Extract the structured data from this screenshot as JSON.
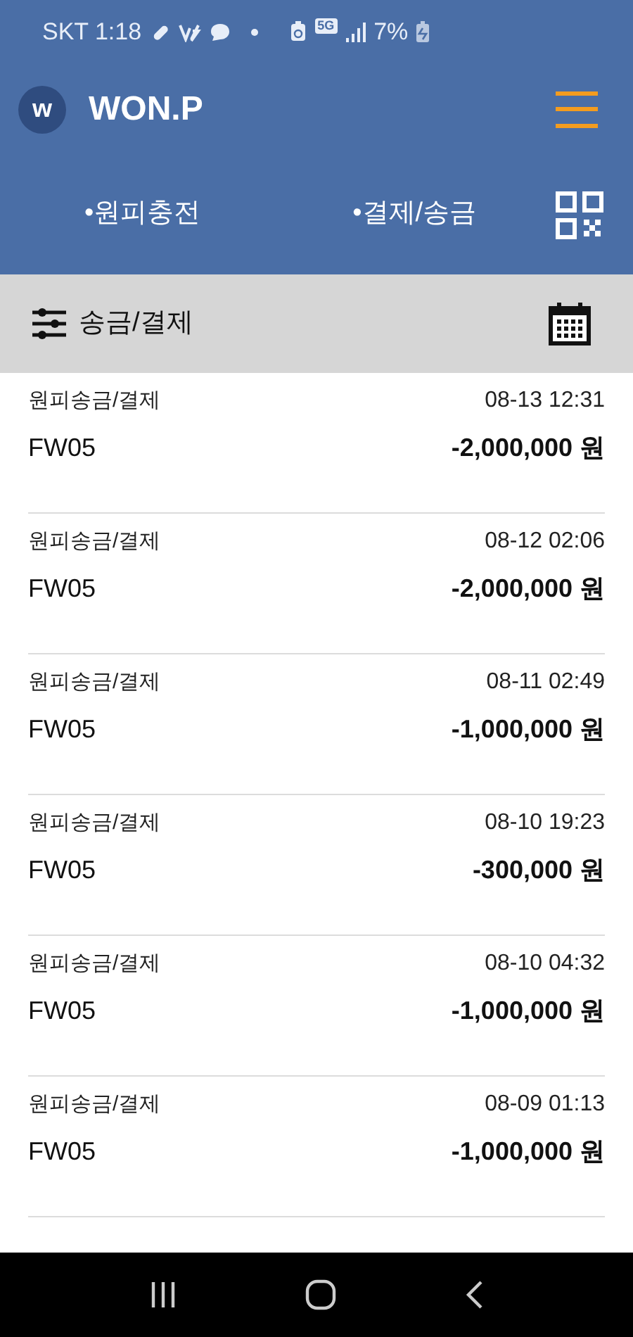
{
  "status_bar": {
    "carrier_time": "SKT 1:18",
    "network": "5G",
    "battery": "7%"
  },
  "header": {
    "app_name": "WON.P",
    "logo_letter": "w"
  },
  "nav": {
    "links": [
      "•원피충전",
      "•결제/송금"
    ]
  },
  "filter_bar": {
    "title": "송금/결제"
  },
  "transactions": [
    {
      "title": "원피송금/결제",
      "time": "08-13 12:31",
      "code": "FW05",
      "amount": "-2,000,000 원"
    },
    {
      "title": "원피송금/결제",
      "time": "08-12 02:06",
      "code": "FW05",
      "amount": "-2,000,000 원"
    },
    {
      "title": "원피송금/결제",
      "time": "08-11 02:49",
      "code": "FW05",
      "amount": "-1,000,000 원"
    },
    {
      "title": "원피송금/결제",
      "time": "08-10 19:23",
      "code": "FW05",
      "amount": "-300,000 원"
    },
    {
      "title": "원피송금/결제",
      "time": "08-10 04:32",
      "code": "FW05",
      "amount": "-1,000,000 원"
    },
    {
      "title": "원피송금/결제",
      "time": "08-09 01:13",
      "code": "FW05",
      "amount": "-1,000,000 원"
    }
  ]
}
